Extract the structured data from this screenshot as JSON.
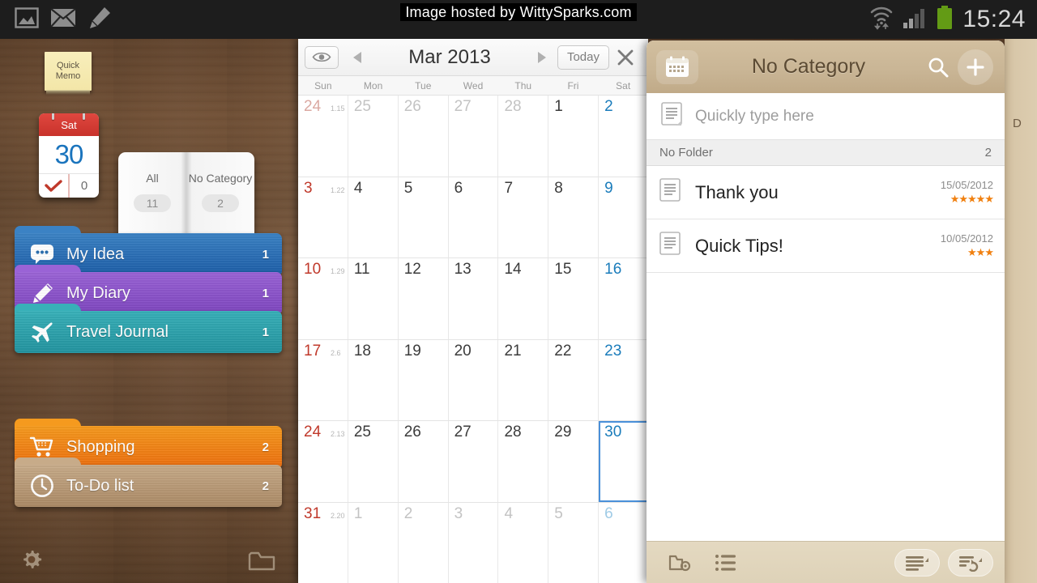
{
  "statusbar": {
    "left_icons": [
      "image-icon",
      "mail-icon",
      "pencil-icon"
    ],
    "right_icons": [
      "wifi-icon",
      "signal-icon",
      "battery-icon"
    ],
    "time": "15:24",
    "battery_color": "#7fcc12"
  },
  "watermark": {
    "text": "Image hosted by WittySparks.com"
  },
  "sidebar": {
    "quick_memo": {
      "line1": "Quick",
      "line2": "Memo"
    },
    "flip_calendar": {
      "weekday": "Sat",
      "day": "30",
      "check_icon": "check-icon",
      "count": "0"
    },
    "book": {
      "pages": [
        {
          "label": "All",
          "count": "11"
        },
        {
          "label": "No Category",
          "count": "2"
        }
      ]
    },
    "folders_top": [
      {
        "name": "My Idea",
        "count": "1",
        "icon": "speech-bubble-icon",
        "color_from": "#3b82c4",
        "color_to": "#1d5ea8"
      },
      {
        "name": "My Diary",
        "count": "1",
        "icon": "pencil-icon",
        "color_from": "#9a63d6",
        "color_to": "#7e46bf"
      },
      {
        "name": "Travel Journal",
        "count": "1",
        "icon": "airplane-icon",
        "color_from": "#38b0b8",
        "color_to": "#2394a0"
      }
    ],
    "folders_bottom": [
      {
        "name": "Shopping",
        "count": "2",
        "icon": "shopping-cart-icon",
        "color_from": "#f59a1e",
        "color_to": "#ed6f10"
      },
      {
        "name": "To-Do list",
        "count": "2",
        "icon": "clock-icon",
        "color_from": "#c3a684",
        "color_to": "#ab8a66"
      }
    ],
    "bottom_icons": {
      "settings": "gear-icon",
      "folder": "folder-icon"
    }
  },
  "calendar": {
    "eye_icon": "eye-icon",
    "prev_icon": "triangle-left-icon",
    "next_icon": "triangle-right-icon",
    "title": "Mar 2013",
    "today_label": "Today",
    "close_icon": "close-icon",
    "weekdays": [
      "Sun",
      "Mon",
      "Tue",
      "Wed",
      "Thu",
      "Fri",
      "Sat"
    ],
    "selected_day": "30",
    "weeks": [
      [
        {
          "d": "24",
          "lunar": "1.15",
          "out": true,
          "kind": "sun"
        },
        {
          "d": "25",
          "out": true,
          "kind": ""
        },
        {
          "d": "26",
          "out": true,
          "kind": ""
        },
        {
          "d": "27",
          "out": true,
          "kind": ""
        },
        {
          "d": "28",
          "out": true,
          "kind": ""
        },
        {
          "d": "1",
          "out": false,
          "kind": ""
        },
        {
          "d": "2",
          "out": false,
          "kind": "sat"
        }
      ],
      [
        {
          "d": "3",
          "lunar": "1.22",
          "out": false,
          "kind": "sun"
        },
        {
          "d": "4",
          "out": false,
          "kind": ""
        },
        {
          "d": "5",
          "out": false,
          "kind": ""
        },
        {
          "d": "6",
          "out": false,
          "kind": ""
        },
        {
          "d": "7",
          "out": false,
          "kind": ""
        },
        {
          "d": "8",
          "out": false,
          "kind": ""
        },
        {
          "d": "9",
          "out": false,
          "kind": "sat"
        }
      ],
      [
        {
          "d": "10",
          "lunar": "1.29",
          "out": false,
          "kind": "sun"
        },
        {
          "d": "11",
          "out": false,
          "kind": ""
        },
        {
          "d": "12",
          "out": false,
          "kind": ""
        },
        {
          "d": "13",
          "out": false,
          "kind": ""
        },
        {
          "d": "14",
          "out": false,
          "kind": ""
        },
        {
          "d": "15",
          "out": false,
          "kind": ""
        },
        {
          "d": "16",
          "out": false,
          "kind": "sat"
        }
      ],
      [
        {
          "d": "17",
          "lunar": "2.6",
          "out": false,
          "kind": "sun"
        },
        {
          "d": "18",
          "out": false,
          "kind": ""
        },
        {
          "d": "19",
          "out": false,
          "kind": ""
        },
        {
          "d": "20",
          "out": false,
          "kind": ""
        },
        {
          "d": "21",
          "out": false,
          "kind": ""
        },
        {
          "d": "22",
          "out": false,
          "kind": ""
        },
        {
          "d": "23",
          "out": false,
          "kind": "sat"
        }
      ],
      [
        {
          "d": "24",
          "lunar": "2.13",
          "out": false,
          "kind": "sun"
        },
        {
          "d": "25",
          "out": false,
          "kind": ""
        },
        {
          "d": "26",
          "out": false,
          "kind": ""
        },
        {
          "d": "27",
          "out": false,
          "kind": ""
        },
        {
          "d": "28",
          "out": false,
          "kind": ""
        },
        {
          "d": "29",
          "out": false,
          "kind": ""
        },
        {
          "d": "30",
          "out": false,
          "kind": "sat",
          "selected": true
        }
      ],
      [
        {
          "d": "31",
          "lunar": "2.20",
          "out": false,
          "kind": "sun"
        },
        {
          "d": "1",
          "out": true,
          "kind": ""
        },
        {
          "d": "2",
          "out": true,
          "kind": ""
        },
        {
          "d": "3",
          "out": true,
          "kind": ""
        },
        {
          "d": "4",
          "out": true,
          "kind": ""
        },
        {
          "d": "5",
          "out": true,
          "kind": ""
        },
        {
          "d": "6",
          "out": true,
          "kind": "sat"
        }
      ]
    ]
  },
  "memo_panel": {
    "header": {
      "calendar_icon": "calendar-icon",
      "title": "No Category",
      "search_icon": "search-icon",
      "add_icon": "plus-icon"
    },
    "quick_input": {
      "icon": "note-icon",
      "placeholder": "Quickly type here"
    },
    "folder_bar": {
      "label": "No Folder",
      "count": "2"
    },
    "items": [
      {
        "icon": "note-icon",
        "title": "Thank you",
        "date": "15/05/2012",
        "stars": "★★★★★",
        "rating": 5
      },
      {
        "icon": "note-icon",
        "title": "Quick Tips!",
        "date": "10/05/2012",
        "stars": "★★★",
        "rating": 3
      }
    ],
    "footer_icons": [
      "folder-settings-icon",
      "list-icon",
      "view-mode-icon",
      "sort-icon"
    ]
  },
  "behind_panel": {
    "char": "D"
  }
}
